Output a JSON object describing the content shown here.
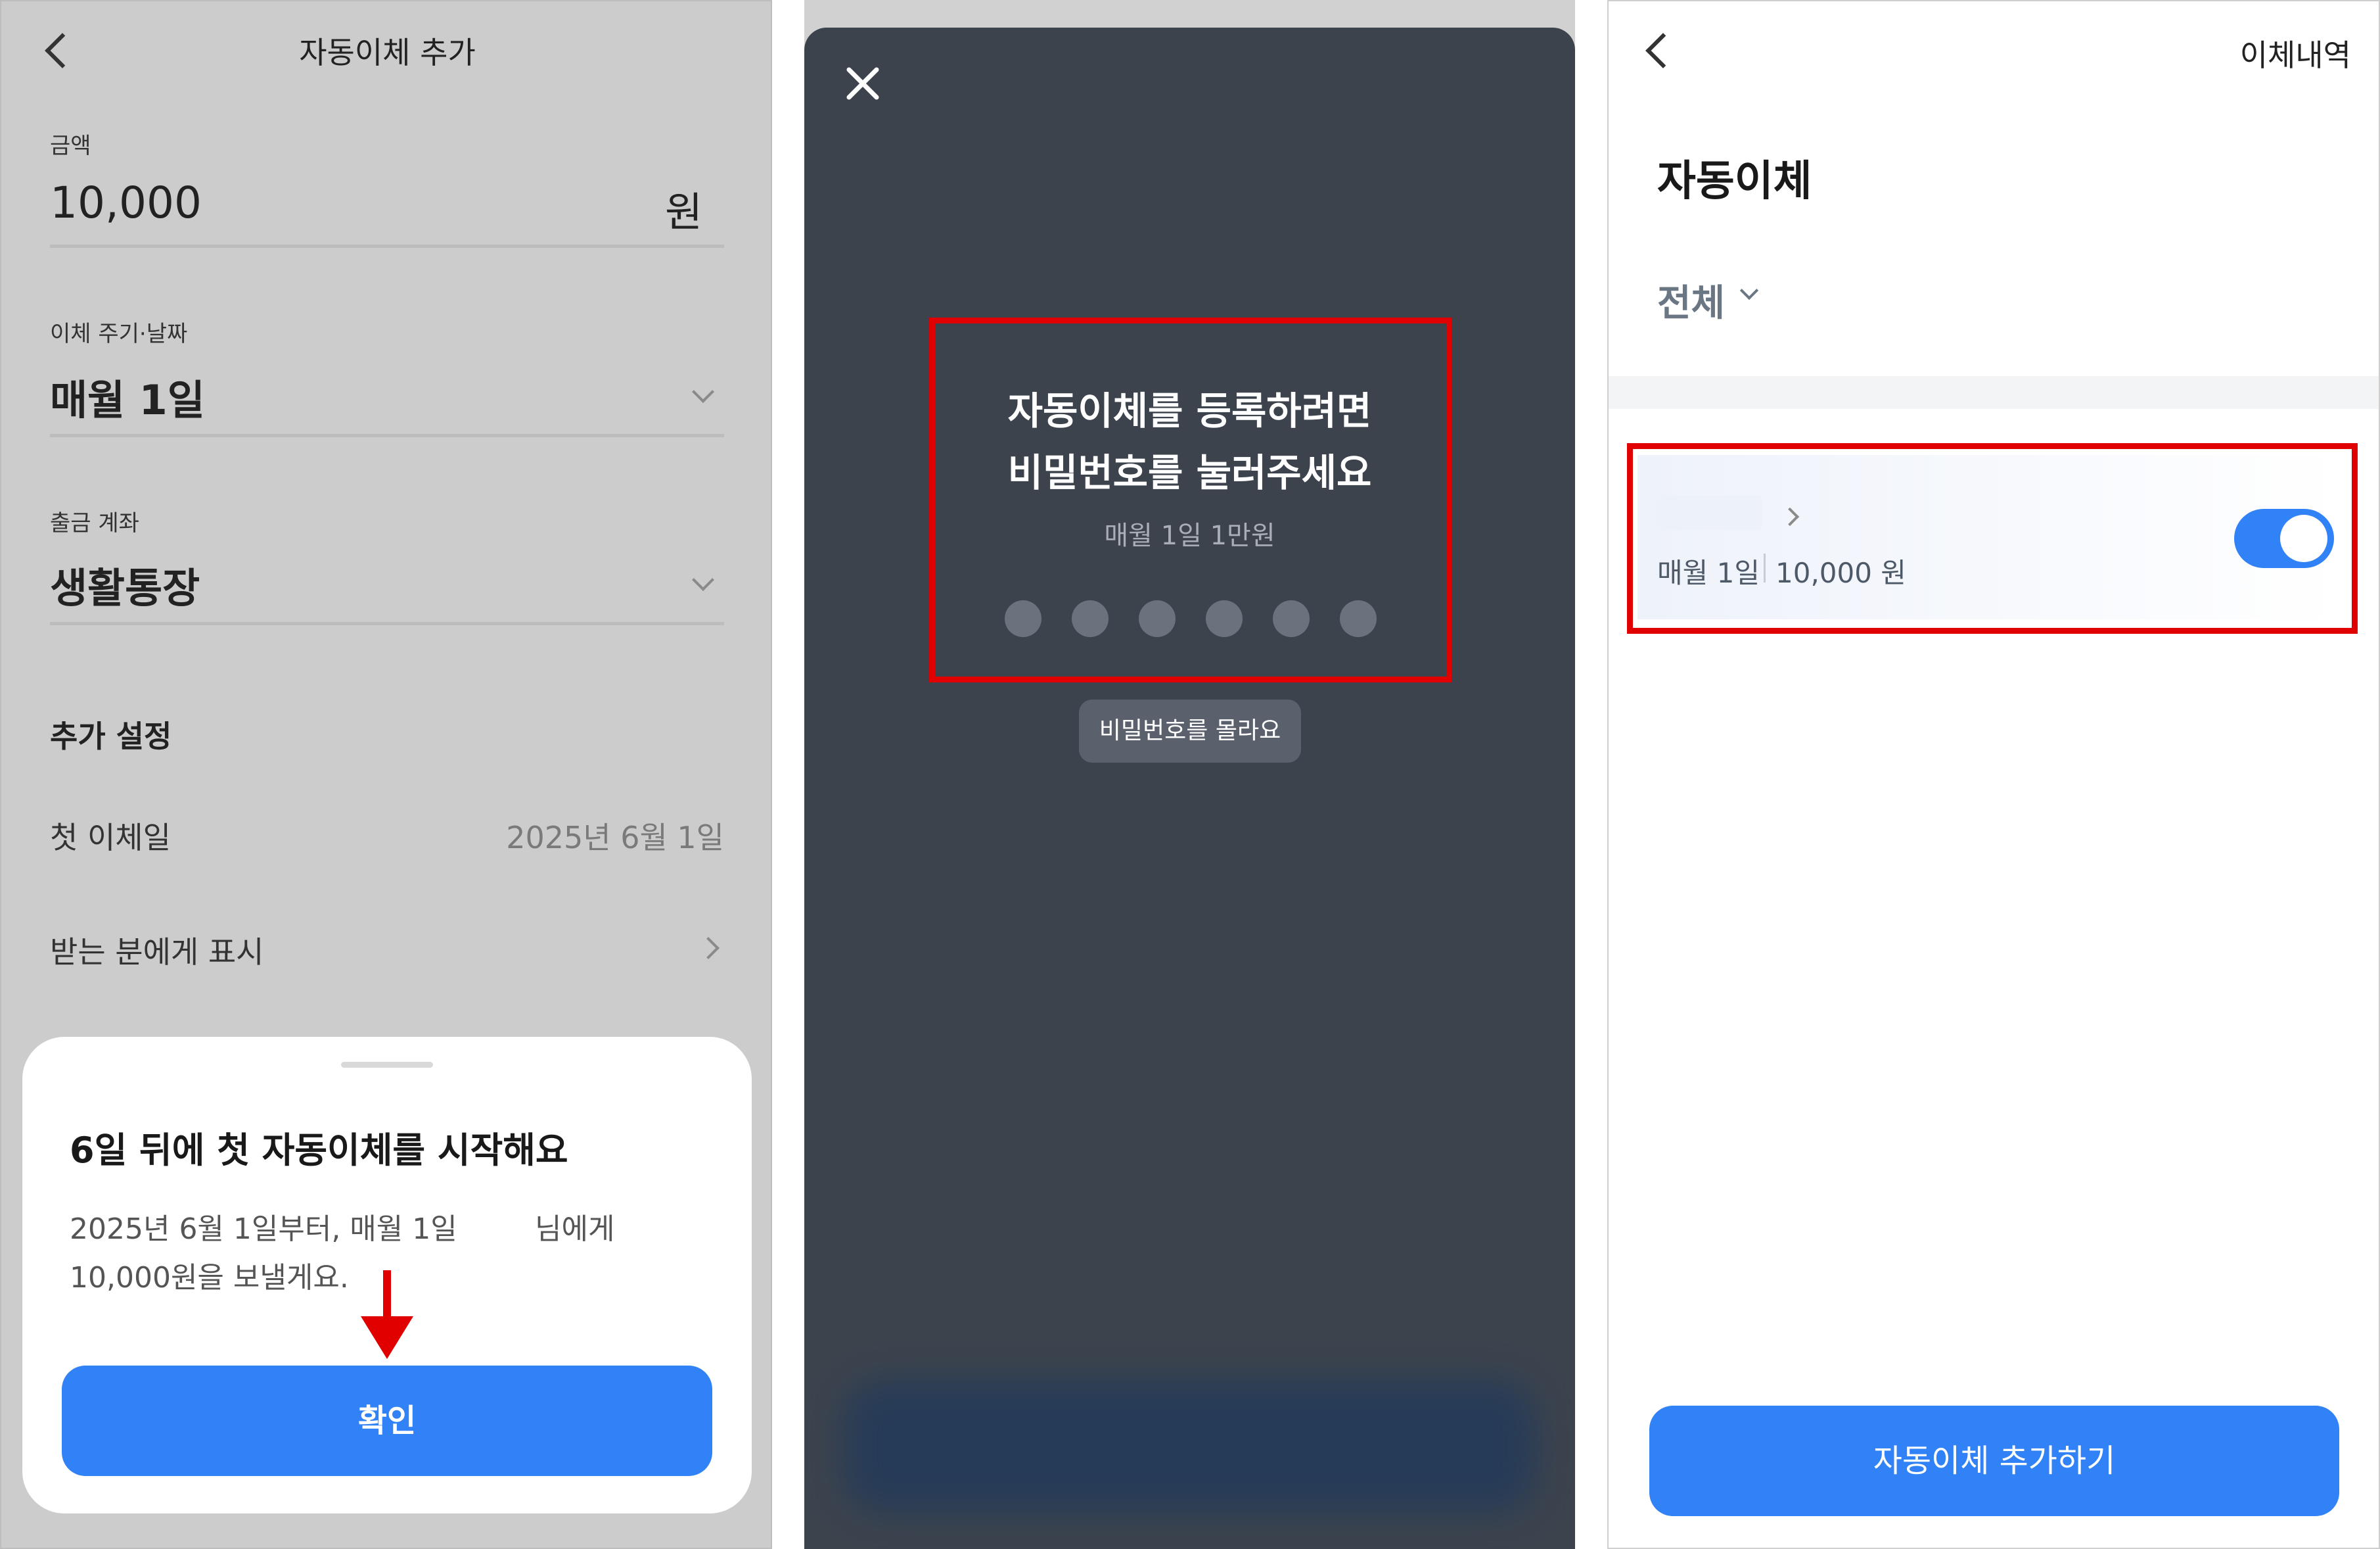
{
  "panel1": {
    "title": "자동이체 추가",
    "amount": {
      "label": "금액",
      "value": "10,000",
      "unit": "원"
    },
    "cycle": {
      "label": "이체 주기·날짜",
      "value": "매월 1일"
    },
    "account": {
      "label": "출금 계좌",
      "value": "생활통장"
    },
    "extra": {
      "heading": "추가 설정",
      "first_date_label": "첫 이체일",
      "first_date_value": "2025년 6월 1일",
      "display_label": "받는 분에게 표시"
    },
    "sheet": {
      "title": "6일 뒤에 첫 자동이체를 시작해요",
      "line1_a": "2025년 6월 1일부터, 매월 1일",
      "line1_b": "님에게",
      "line2": "10,000원을 보낼게요.",
      "confirm": "확인"
    }
  },
  "panel2": {
    "line1": "자동이체를 등록하려면",
    "line2": "비밀번호를 눌러주세요",
    "sub": "매월 1일 1만원",
    "pin_count": 6,
    "forgot": "비밀번호를 몰라요"
  },
  "panel3": {
    "history": "이체내역",
    "title": "자동이체",
    "filter": "전체",
    "item_schedule": "매월 1일",
    "item_amount": "10,000 원",
    "toggle_on": true,
    "add_button": "자동이체 추가하기"
  },
  "colors": {
    "accent": "#3182f6",
    "highlight": "#e00000",
    "arrow": "#e00000"
  }
}
